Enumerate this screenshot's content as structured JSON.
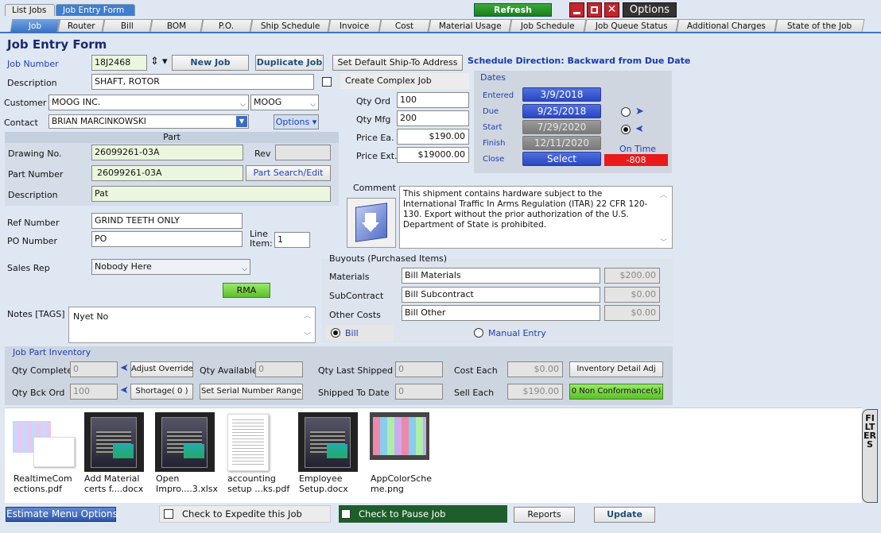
{
  "top_tabs": [
    "List Jobs",
    "Job Entry Form"
  ],
  "refresh": "Refresh",
  "options": "Options",
  "nav_tabs": [
    "Job",
    "Router",
    "Bill",
    "BOM",
    "P.O.",
    "Ship Schedule",
    "Invoice",
    "Cost",
    "Material Usage",
    "Job Schedule",
    "Job Queue Status",
    "Additional Charges",
    "State of the Job"
  ],
  "title": "Job Entry Form",
  "job_number_label": "Job Number",
  "job_number": "18J2468",
  "new_job": "New Job",
  "duplicate_job": "Duplicate Job",
  "set_default_ship": "Set Default Ship-To Address",
  "schedule_direction": "Schedule Direction: Backward from Due Date",
  "description_label": "Description",
  "description": "SHAFT, ROTOR",
  "create_complex": "Create Complex Job",
  "customer_label": "Customer",
  "customer": "MOOG INC.",
  "customer_code": "MOOG",
  "contact_label": "Contact",
  "contact": "BRIAN MARCINKOWSKI",
  "options_btn": "Options",
  "qty_ord_label": "Qty Ord",
  "qty_ord": "100",
  "qty_mfg_label": "Qty Mfg",
  "qty_mfg": "200",
  "price_ea_label": "Price Ea.",
  "price_ea": "$190.00",
  "price_ext_label": "Price Ext.",
  "price_ext": "$19000.00",
  "part_header": "Part",
  "drawing_label": "Drawing No.",
  "drawing": "26099261-03A",
  "rev_label": "Rev",
  "part_number_label": "Part Number",
  "part_number": "26099261-03A",
  "part_search": "Part Search/Edit",
  "part_desc_label": "Description",
  "part_desc": "Pat",
  "dates": {
    "header": "Dates",
    "entered_label": "Entered",
    "entered": "3/9/2018",
    "due_label": "Due",
    "due": "9/25/2018",
    "start_label": "Start",
    "start": "7/29/2020",
    "finish_label": "Finish",
    "finish": "12/11/2020",
    "close_label": "Close",
    "close": "Select",
    "on_time_label": "On Time",
    "on_time": "-808"
  },
  "comment_label": "Comment",
  "comment": "This shipment contains hardware subject to the International Traffic In Arms Regulation (ITAR) 22 CFR 120-130. Export without the prior authorization of the U.S. Department of State is prohibited.",
  "ref_label": "Ref Number",
  "ref": "GRIND TEETH ONLY",
  "po_label": "PO Number",
  "po": "PO",
  "line_item_label": "Line Item:",
  "line_item": "1",
  "sales_rep_label": "Sales Rep",
  "sales_rep": "Nobody Here",
  "rma": "RMA",
  "notes_label": "Notes [TAGS]",
  "notes": "Nyet No",
  "buyouts_header": "Buyouts  (Purchased Items)",
  "materials_label": "Materials",
  "materials": "Bill Materials",
  "materials_amt": "$200.00",
  "subcontract_label": "SubContract",
  "subcontract": "Bill Subcontract",
  "subcontract_amt": "$0.00",
  "other_label": "Other Costs",
  "other": "Bill Other",
  "other_amt": "$0.00",
  "bill_radio": "Bill",
  "manual_radio": "Manual Entry",
  "inv_header": "Job Part Inventory",
  "qty_complete_label": "Qty Complete",
  "qty_complete": "0",
  "adjust_override": "Adjust Override",
  "qty_available_label": "Qty Available",
  "qty_available": "0",
  "qty_last_shipped_label": "Qty Last Shipped",
  "qty_last_shipped": "0",
  "cost_each_label": "Cost Each",
  "cost_each": "$0.00",
  "inv_detail": "Inventory Detail Adj",
  "qty_bck_label": "Qty Bck Ord",
  "qty_bck": "100",
  "shortage": "Shortage( 0 )",
  "serial": "Set Serial Number Range",
  "shipped_label": "Shipped To Date",
  "shipped": "0",
  "sell_each_label": "Sell Each",
  "sell_each": "$190.00",
  "nonconf": "0 Non Conformance(s)",
  "files": [
    {
      "name": "RealtimeCorr ections.pdf",
      "line1": "RealtimeCom",
      "line2": "ections.pdf"
    },
    {
      "line1": "Add Material",
      "line2": "certs f....docx"
    },
    {
      "line1": "Open",
      "line2": "Impro....3.xlsx"
    },
    {
      "line1": "accounting",
      "line2": "setup ...ks.pdf"
    },
    {
      "line1": "Employee",
      "line2": "Setup.docx"
    },
    {
      "line1": "AppColorSche",
      "line2": "me.png"
    }
  ],
  "filters": "FILTERS",
  "estimate_menu": "Estimate Menu Options",
  "expedite": "Check to Expedite this Job",
  "pause": "Check to Pause Job",
  "reports": "Reports",
  "update": "Update"
}
